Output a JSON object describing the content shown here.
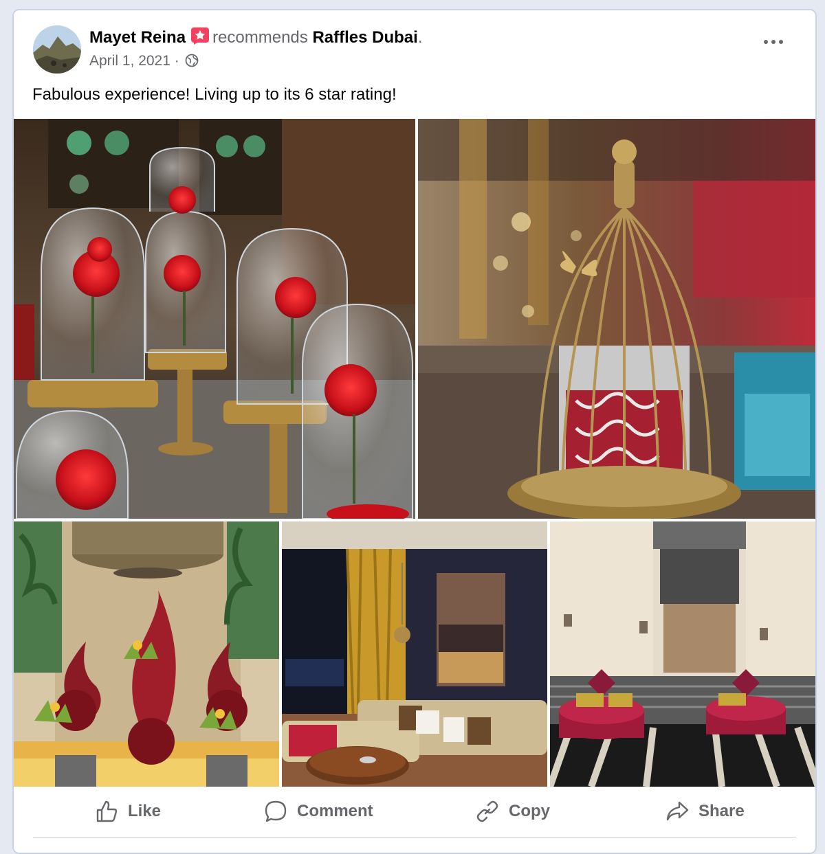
{
  "post": {
    "author": "Mayet Reina",
    "recommends_text": "recommends",
    "place": "Raffles Dubai",
    "period": ".",
    "date": "April 1, 2021",
    "separator": " · ",
    "text": "Fabulous experience! Living up to its 6 star rating!",
    "privacy_icon": "globe-icon",
    "menu_icon": "more-options-icon"
  },
  "photos": [
    {
      "subject": "roses-in-glass-domes-photo"
    },
    {
      "subject": "golden-birdcage-tea-tin-photo"
    },
    {
      "subject": "lobby-red-flame-sculptures-photo"
    },
    {
      "subject": "suite-living-room-photo"
    },
    {
      "subject": "lobby-red-ottomans-photo"
    }
  ],
  "actions": {
    "like": "Like",
    "comment": "Comment",
    "copy": "Copy",
    "share": "Share"
  },
  "colors": {
    "accent_badge": "#f3425f",
    "secondary_text": "#65676b",
    "card_border": "#c9d4ea"
  }
}
